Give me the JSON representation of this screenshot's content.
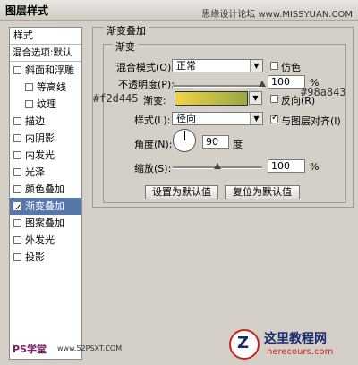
{
  "window": {
    "title": "图层样式",
    "watermark": "思缘设计论坛 www.MISSYUAN.COM"
  },
  "sidebar": {
    "header": "样式",
    "blend_options": "混合选项:默认",
    "items": [
      {
        "label": "斜面和浮雕",
        "checked": false,
        "sub": false
      },
      {
        "label": "等高线",
        "checked": false,
        "sub": true
      },
      {
        "label": "纹理",
        "checked": false,
        "sub": true
      },
      {
        "label": "描边",
        "checked": false,
        "sub": false
      },
      {
        "label": "内阴影",
        "checked": false,
        "sub": false
      },
      {
        "label": "内发光",
        "checked": false,
        "sub": false
      },
      {
        "label": "光泽",
        "checked": false,
        "sub": false
      },
      {
        "label": "颜色叠加",
        "checked": false,
        "sub": false
      },
      {
        "label": "渐变叠加",
        "checked": true,
        "sub": false,
        "active": true
      },
      {
        "label": "图案叠加",
        "checked": false,
        "sub": false
      },
      {
        "label": "外发光",
        "checked": false,
        "sub": false
      },
      {
        "label": "投影",
        "checked": false,
        "sub": false
      }
    ]
  },
  "gradient_overlay": {
    "title": "渐变叠加",
    "section": "渐变",
    "blend_mode_label": "混合模式(O):",
    "blend_mode_value": "正常",
    "dither_label": "仿色",
    "opacity_label": "不透明度(P):",
    "opacity_value": "100",
    "opacity_unit": "%",
    "opacity_level": 1.0,
    "gradient_label": "渐变:",
    "reverse_label": "反向(R)",
    "style_label": "样式(L):",
    "style_value": "径向",
    "align_label": "与图层对齐(I)",
    "angle_label": "角度(N):",
    "angle_value": "90",
    "angle_unit": "度",
    "scale_label": "缩放(S):",
    "scale_value": "100",
    "scale_unit": "%",
    "scale_level": 0.5,
    "set_default": "设置为默认值",
    "reset_default": "复位为默认值"
  },
  "annotations": {
    "color_left": "#f2d445",
    "color_right": "#98a843"
  },
  "footer": {
    "left_logo": "PS学堂",
    "left_url": "www.52PSXT.COM",
    "brand_cn": "这里教程网",
    "brand_url": "herecours.com"
  },
  "colors": {
    "gradient_start": "#f2d445",
    "gradient_end": "#98a843",
    "selected": "#5577aa"
  }
}
